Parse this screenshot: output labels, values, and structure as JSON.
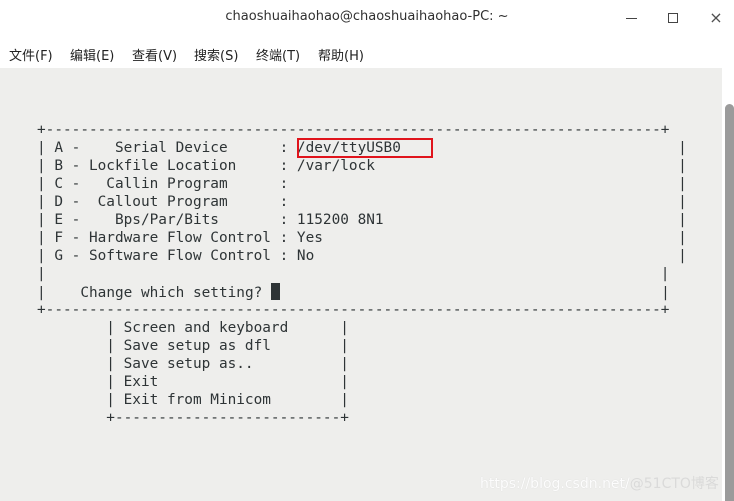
{
  "window": {
    "title": "chaoshuaihaohao@chaoshuaihaohao-PC: ~",
    "controls": {
      "minimize": "minimize",
      "maximize": "maximize",
      "close": "×"
    }
  },
  "menubar": {
    "items": [
      {
        "label": "文件(F)"
      },
      {
        "label": "编辑(E)"
      },
      {
        "label": "查看(V)"
      },
      {
        "label": "搜索(S)"
      },
      {
        "label": "终端(T)"
      },
      {
        "label": "帮助(H)"
      }
    ]
  },
  "minicom": {
    "box_top": "+-----------------------------------------------------------------------+",
    "settings": [
      {
        "text": "| A -    Serial Device      : /dev/ttyUSB0                                |",
        "key": "A",
        "label": "Serial Device",
        "value": "/dev/ttyUSB0"
      },
      {
        "text": "| B - Lockfile Location     : /var/lock                                   |",
        "key": "B",
        "label": "Lockfile Location",
        "value": "/var/lock"
      },
      {
        "text": "| C -   Callin Program      :                                             |",
        "key": "C",
        "label": "Callin Program",
        "value": ""
      },
      {
        "text": "| D -  Callout Program      :                                             |",
        "key": "D",
        "label": "Callout Program",
        "value": ""
      },
      {
        "text": "| E -    Bps/Par/Bits       : 115200 8N1                                  |",
        "key": "E",
        "label": "Bps/Par/Bits",
        "value": "115200 8N1"
      },
      {
        "text": "| F - Hardware Flow Control : Yes                                         |",
        "key": "F",
        "label": "Hardware Flow Control",
        "value": "Yes"
      },
      {
        "text": "| G - Software Flow Control : No                                          |",
        "key": "G",
        "label": "Software Flow Control",
        "value": "No"
      }
    ],
    "blank_line": "|                                                                       |",
    "prompt_prefix": "|    ",
    "prompt": "Change which setting? ",
    "prompt_suffix": "                                            |",
    "box_bottom": "+-----------------------------------------------------------------------+",
    "menu": [
      {
        "text": "        | Screen and keyboard      |",
        "label": "Screen and keyboard"
      },
      {
        "text": "        | Save setup as dfl        |",
        "label": "Save setup as dfl"
      },
      {
        "text": "        | Save setup as..          |",
        "label": "Save setup as.."
      },
      {
        "text": "        | Exit                     |",
        "label": "Exit"
      },
      {
        "text": "        | Exit from Minicom        |",
        "label": "Exit from Minicom"
      }
    ],
    "menu_bottom": "        +--------------------------+",
    "highlight_color": "#e0141c"
  },
  "watermark": {
    "url": "https://blog.csdn.net/",
    "brand": "@51CTO博客"
  }
}
